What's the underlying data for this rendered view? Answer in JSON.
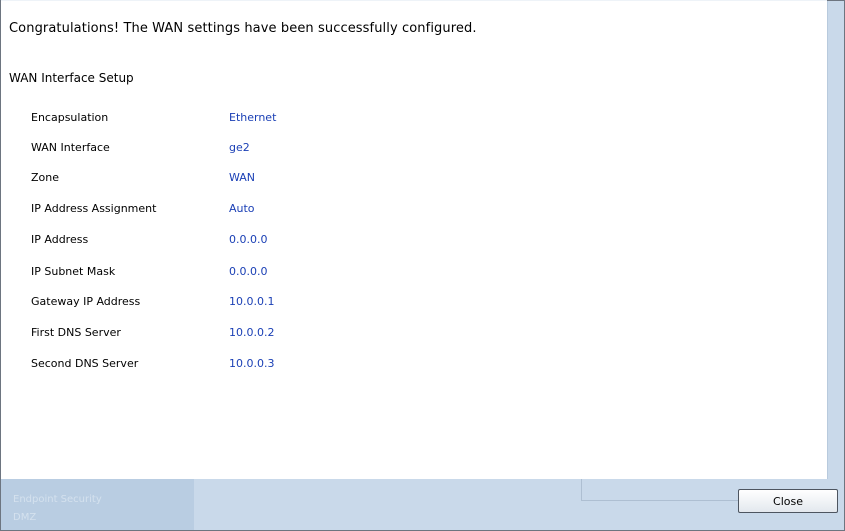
{
  "headline": "Congratulations! The WAN settings have been successfully configured.",
  "section_title": "WAN Interface Setup",
  "rows": [
    {
      "label": "Encapsulation",
      "value": "Ethernet"
    },
    {
      "label": "WAN Interface",
      "value": "ge2"
    },
    {
      "label": "Zone",
      "value": "WAN"
    },
    {
      "label": "IP Address Assignment",
      "value": "Auto"
    },
    {
      "label": "IP Address",
      "value": "0.0.0.0"
    },
    {
      "label": "IP Subnet Mask",
      "value": "0.0.0.0"
    },
    {
      "label": "Gateway IP Address",
      "value": "10.0.0.1"
    },
    {
      "label": "First DNS Server",
      "value": "10.0.0.2"
    },
    {
      "label": "Second DNS Server",
      "value": "10.0.0.3"
    }
  ],
  "footer": {
    "ghost_line_1": "Endpoint Security",
    "ghost_line_2": "DMZ",
    "close_label": "Close"
  },
  "colors": {
    "value_text": "#1a3fb5",
    "footer_bg": "#c9d9ea"
  }
}
